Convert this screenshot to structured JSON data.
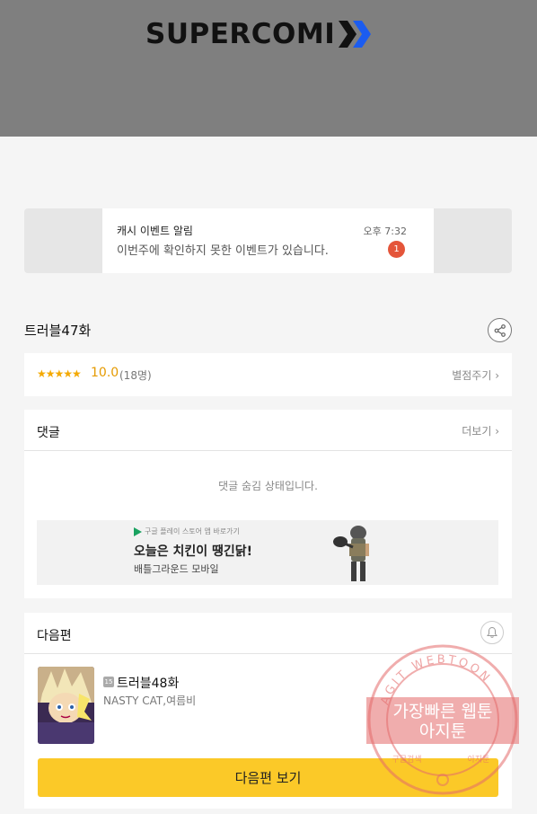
{
  "brand": {
    "logo_text": "SUPERCOMI"
  },
  "notification": {
    "title": "캐시 이벤트 알림",
    "message": "이번주에 확인하지 못한 이벤트가 있습니다.",
    "time": "오후 7:32",
    "badge_count": "1"
  },
  "episode": {
    "title": "트러블47화",
    "share_icon": "share-icon"
  },
  "rating": {
    "stars": "★★★★★",
    "score": "10.0",
    "count": "(18명)",
    "rate_link": "별점주기 ›"
  },
  "comments": {
    "title": "댓글",
    "more_link": "더보기 ›",
    "hidden_message": "댓글 숨김 상태입니다."
  },
  "ad": {
    "small_text": "구글 플레이 스토어 앱 바로가기",
    "title": "오늘은 치킨이 땡긴닭!",
    "subtitle": "배틀그라운드 모바일"
  },
  "next": {
    "section_title": "다음편",
    "age_rating": "15",
    "episode_title": "트러블48화",
    "authors": "NASTY CAT,여름비",
    "button_label": "다음편 보기"
  },
  "watermark": {
    "ring_text": "AGIT WEBTOON",
    "line1": "가장빠른 웹툰",
    "line2": "아지툰",
    "bottom_left": "구글검색",
    "bottom_right": "아지툰"
  },
  "colors": {
    "header_bg": "#7f7f7f",
    "accent_yellow": "#fbc928",
    "star_orange": "#f4a900",
    "badge_red": "#e4553a",
    "logo_x_blue": "#1b5cf0"
  }
}
